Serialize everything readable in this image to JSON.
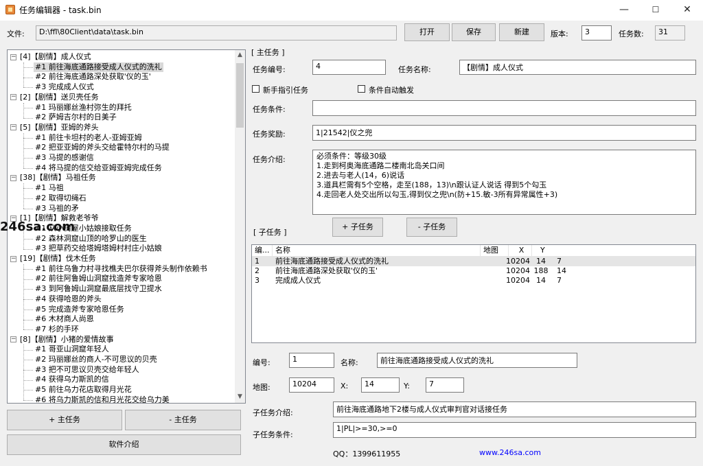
{
  "window": {
    "title": "任务编辑器 - task.bin",
    "minimize": "—",
    "maximize": "☐",
    "close": "✕"
  },
  "file_bar": {
    "label": "文件:",
    "path": "D:\\ffl\\80Client\\data\\task.bin",
    "open": "打开",
    "save": "保存",
    "new": "新建",
    "version_label": "版本:",
    "version": "3",
    "count_label": "任务数:",
    "count": "31"
  },
  "tree": {
    "groups": [
      {
        "label": "[4]【剧情】成人仪式",
        "children": [
          "#1 前往海底通路接受成人仪式的洗礼",
          "#2 前往海底通路深处获取'仪的玉'",
          "#3 完成成人仪式"
        ]
      },
      {
        "label": "[2]【剧情】送贝壳任务",
        "children": [
          "#1 玛丽娜丝渔村弥生的拜托",
          "#2 萨姆吉尔村的日美子"
        ]
      },
      {
        "label": "[5]【剧情】亚姆的斧头",
        "children": [
          "#1 前往卡坦村的老人-亚姆亚姆",
          "#2 把亚亚姆的斧头交给霍特尔村的马提",
          "#3 马提的感谢信",
          "#4 将马提的信交给亚姆亚姆完成任务"
        ]
      },
      {
        "label": "[38]【剧情】马祖任务",
        "children": [
          "#1 马祖",
          "#2 取得切绳石",
          "#3 马祖的矛"
        ]
      },
      {
        "label": "[1]【剧情】解救老爷爷",
        "children": [
          "#1 从小树屋小姑娘接取任务",
          "#2 森林洞窟山顶的哈罗山的医生",
          "#3 把草药交给塔姆塔姆村村庄小姑娘"
        ]
      },
      {
        "label": "[19]【剧情】伐木任务",
        "children": [
          "#1 前往乌鲁力村寻找樵夫巴尔获得斧头制作依赖书",
          "#2 前往阿鲁姆山洞窟找造斧专家哈恩",
          "#3 到阿鲁姆山洞窟最底层找守卫提水",
          "#4 获得哈恩的斧头",
          "#5 完成造斧专家哈恩任务",
          "#6 木材商人尚恩",
          "#7 杉的手环"
        ]
      },
      {
        "label": "[8]【剧情】小猪的爱情故事",
        "children": [
          "#1 哥亚山洞窟年轻人",
          "#2 玛丽娜丝的商人-不可思议的贝壳",
          "#3 把不可思议贝壳交给年轻人",
          "#4 获得乌力斯凯的信",
          "#5 前往乌力花店取得月光花",
          "#6 将乌力斯凯的信和月光花交给乌力美"
        ]
      }
    ],
    "selected": "#1 前往海底通路接受成人仪式的洗礼",
    "scroll_up": "▲",
    "scroll_down": "▼"
  },
  "left_buttons": {
    "add_main": "+ 主任务",
    "remove_main": "- 主任务",
    "about": "软件介绍"
  },
  "main_task": {
    "section": "[ 主任务 ]",
    "id_label": "任务编号:",
    "id": "4",
    "name_label": "任务名称:",
    "name": "【剧情】成人仪式",
    "newbie_label": "新手指引任务",
    "auto_label": "条件自动触发",
    "cond_label": "任务条件:",
    "cond": "",
    "reward_label": "任务奖励:",
    "reward": "1|21542|仪之兜",
    "intro_label": "任务介绍:",
    "intro_lines": [
      "必须条件：等级30级",
      "1.走到柯奥海底通路二楼南北岛关口间",
      "2.进去与老人(14，6)说话",
      "3.道具栏需有5个空格，走至(188，13)\\n跟认证人说话 得到5个勾玉",
      "4.走回老人处交出所以勾玉,得到仪之兜\\n(防+15.敏-3所有异常属性+3)"
    ]
  },
  "sub_task": {
    "section": "[ 子任务 ]",
    "add": "+ 子任务",
    "remove": "- 子任务",
    "columns": [
      "编...",
      "名称",
      "地图",
      "X",
      "Y"
    ],
    "rows": [
      {
        "no": "1",
        "name": "前往海底通路接受成人仪式的洗礼",
        "map": "10204",
        "x": "14",
        "y": "7"
      },
      {
        "no": "2",
        "name": "前往海底通路深处获取'仪的玉'",
        "map": "10204",
        "x": "188",
        "y": "14"
      },
      {
        "no": "3",
        "name": "完成成人仪式",
        "map": "10204",
        "x": "14",
        "y": "7"
      }
    ],
    "no_label": "编号:",
    "no": "1",
    "name_label": "名称:",
    "name": "前往海底通路接受成人仪式的洗礼",
    "map_label": "地图:",
    "map": "10204",
    "x_label": "X:",
    "x": "14",
    "y_label": "Y:",
    "y": "7",
    "intro_label": "子任务介绍:",
    "intro": "前往海底通路地下2楼与成人仪式审判官对话接任务",
    "cond_label": "子任务条件:",
    "cond": "1|PL|>=30,>=0"
  },
  "footer": {
    "qq": "QQ：1399611955",
    "site": "www.246sa.com"
  },
  "watermark": "246sa.com"
}
